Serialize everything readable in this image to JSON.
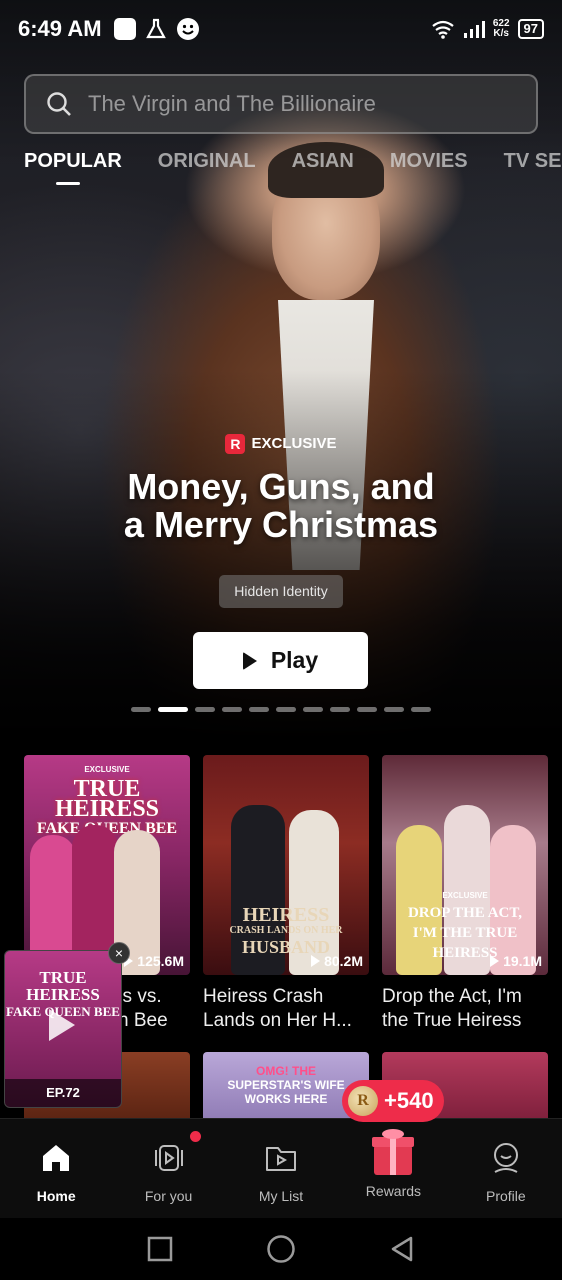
{
  "status_bar": {
    "time": "6:49 AM",
    "net_speed_value": "622",
    "net_speed_unit": "K/s",
    "battery": "97"
  },
  "search": {
    "placeholder": "The Virgin and The Billionaire"
  },
  "tabs": [
    {
      "label": "POPULAR",
      "active": true
    },
    {
      "label": "ORIGINAL",
      "active": false
    },
    {
      "label": "ASIAN",
      "active": false
    },
    {
      "label": "MOVIES",
      "active": false
    },
    {
      "label": "TV SERI",
      "active": false
    }
  ],
  "hero": {
    "badge_letter": "R",
    "badge_text": "EXCLUSIVE",
    "title_line1": "Money, Guns, and",
    "title_line2": "a Merry Christmas",
    "genre": "Hidden Identity",
    "play_label": "Play",
    "carousel_active_index": 1,
    "carousel_count": 11
  },
  "cards": [
    {
      "poster_badge": "EXCLUSIVE",
      "poster_title_1": "TRUE HEIRESS",
      "poster_title_2": "FAKE QUEEN BEE",
      "views": "125.6M",
      "title": "True Heiress vs. Fake Queen Bee"
    },
    {
      "poster_title_1": "HEIRESS",
      "poster_title_2": "CRASH LANDS ON HER",
      "poster_title_3": "HUSBAND",
      "views": "80.2M",
      "title": "Heiress Crash Lands on Her H..."
    },
    {
      "poster_badge": "EXCLUSIVE",
      "poster_title_1": "DROP THE ACT,",
      "poster_title_2": "I'M THE TRUE",
      "poster_title_3": "HEIRESS",
      "views": "19.1M",
      "title": "Drop the Act, I'm the True Heiress"
    }
  ],
  "row2": {
    "card2_text_1": "OMG! THE",
    "card2_text_2": "SUPERSTAR'S WIFE",
    "card2_text_3": "WORKS HERE"
  },
  "mini_player": {
    "title_1": "TRUE HEIRESS",
    "title_2": "FAKE QUEEN BEE",
    "episode": "EP.72",
    "close": "×"
  },
  "rewards_bubble": {
    "coin_letter": "R",
    "amount": "+540"
  },
  "bottom_nav": [
    {
      "label": "Home",
      "icon": "home-icon",
      "active": true
    },
    {
      "label": "For you",
      "icon": "for-you-icon",
      "active": false,
      "dot": true
    },
    {
      "label": "My List",
      "icon": "folder-play-icon",
      "active": false
    },
    {
      "label": "Rewards",
      "icon": "gift-icon",
      "active": false
    },
    {
      "label": "Profile",
      "icon": "profile-icon",
      "active": false
    }
  ],
  "colors": {
    "accent": "#ee2c4a",
    "background": "#000000"
  }
}
